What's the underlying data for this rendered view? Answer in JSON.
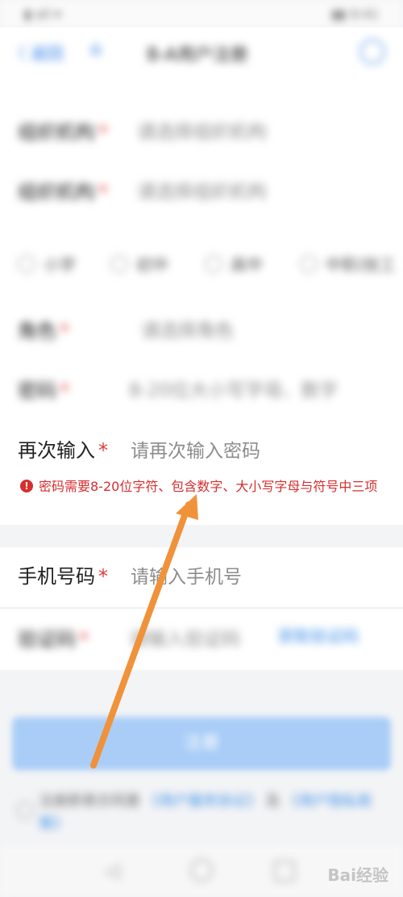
{
  "status_bar": {
    "left": "▮ all ▾ ",
    "right": "▮▮ 9:41"
  },
  "header": {
    "back_label": "〈 返回",
    "home_icon": "home-icon",
    "title": "B-A用户注册",
    "menu_icon": "menu-icon"
  },
  "form": {
    "fields": [
      {
        "label": "组织机构",
        "placeholder": "请选择组织机构"
      },
      {
        "label": "组织机构",
        "placeholder": "请选择组织机构"
      },
      {
        "label": "角色",
        "placeholder": "请选择角色"
      },
      {
        "label": "密码",
        "placeholder": "8-20位大小写字母、数字"
      },
      {
        "label": "再次输入",
        "placeholder": "请再次输入密码"
      },
      {
        "label": "手机号码",
        "placeholder": "请输入手机号"
      },
      {
        "label": "验证码",
        "placeholder": "请输入验证码"
      }
    ],
    "radio_options": [
      "小学",
      "初中",
      "高中",
      "中职/技工"
    ],
    "required_mark": "*",
    "error_message": "密码需要8-20位字符、包含数字、大小写字母与符号中三项",
    "error_icon": "!",
    "get_code_label": "获取验证码"
  },
  "submit_label": "注册",
  "agreement": {
    "prefix": "注册即表示同意",
    "link1": "《用户服务协议》",
    "and": "及",
    "link2": "《用户隐私政策》"
  },
  "navbar": {
    "back_icon": "triangle-back-icon",
    "home_icon": "circle-home-icon",
    "recent_icon": "square-recent-icon"
  },
  "watermark": "Bai经验",
  "colors": {
    "accent": "#2b7be8",
    "error": "#d72e2e",
    "arrow": "#f0923a",
    "button_disabled": "#a9cdf7"
  }
}
